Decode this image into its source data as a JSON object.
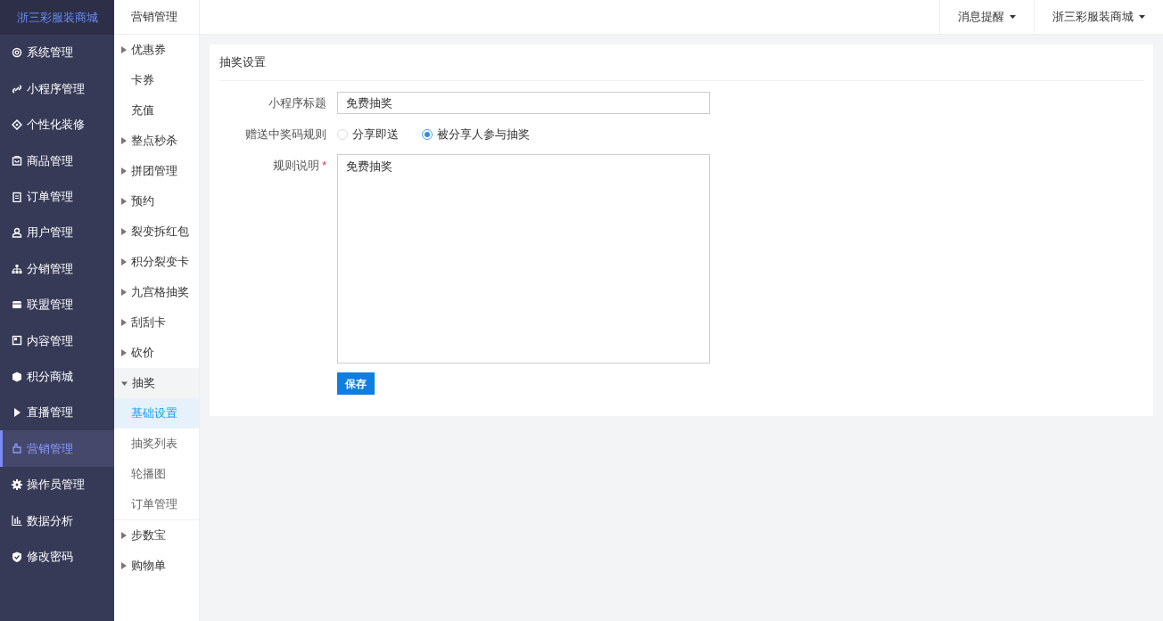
{
  "brand": "浙三彩服装商城",
  "sidebar": {
    "items": [
      {
        "label": "系统管理",
        "selected": false
      },
      {
        "label": "小程序管理",
        "selected": false
      },
      {
        "label": "个性化装修",
        "selected": false
      },
      {
        "label": "商品管理",
        "selected": false
      },
      {
        "label": "订单管理",
        "selected": false
      },
      {
        "label": "用户管理",
        "selected": false
      },
      {
        "label": "分销管理",
        "selected": false
      },
      {
        "label": "联盟管理",
        "selected": false
      },
      {
        "label": "内容管理",
        "selected": false
      },
      {
        "label": "积分商城",
        "selected": false
      },
      {
        "label": "直播管理",
        "selected": false
      },
      {
        "label": "营销管理",
        "selected": true
      },
      {
        "label": "操作员管理",
        "selected": false
      },
      {
        "label": "数据分析",
        "selected": false
      },
      {
        "label": "修改密码",
        "selected": false
      }
    ]
  },
  "submenu": {
    "title": "营销管理",
    "items": [
      {
        "label": "优惠券",
        "kind": "group",
        "expanded": false
      },
      {
        "label": "卡券",
        "kind": "leaf"
      },
      {
        "label": "充值",
        "kind": "leaf"
      },
      {
        "label": "整点秒杀",
        "kind": "group",
        "expanded": false
      },
      {
        "label": "拼团管理",
        "kind": "group",
        "expanded": false
      },
      {
        "label": "预约",
        "kind": "group",
        "expanded": false
      },
      {
        "label": "裂变拆红包",
        "kind": "group",
        "expanded": false
      },
      {
        "label": "积分裂变卡",
        "kind": "group",
        "expanded": false
      },
      {
        "label": "九宫格抽奖",
        "kind": "group",
        "expanded": false
      },
      {
        "label": "刮刮卡",
        "kind": "group",
        "expanded": false
      },
      {
        "label": "砍价",
        "kind": "group",
        "expanded": false
      },
      {
        "label": "抽奖",
        "kind": "group",
        "expanded": true,
        "children": [
          {
            "label": "基础设置",
            "selected": true
          },
          {
            "label": "抽奖列表",
            "selected": false
          },
          {
            "label": "轮播图",
            "selected": false
          },
          {
            "label": "订单管理",
            "selected": false
          }
        ]
      },
      {
        "label": "步数宝",
        "kind": "group",
        "expanded": false
      },
      {
        "label": "购物单",
        "kind": "group",
        "expanded": false
      }
    ]
  },
  "topbar": {
    "menus": [
      "消息提醒",
      "浙三彩服装商城"
    ]
  },
  "card": {
    "title": "抽奖设置",
    "title_field": {
      "label": "小程序标题",
      "value": "免费抽奖"
    },
    "rule_field": {
      "label": "赠送中奖码规则",
      "options": [
        {
          "label": "分享即送",
          "selected": false
        },
        {
          "label": "被分享人参与抽奖",
          "selected": true
        }
      ]
    },
    "desc_field": {
      "label": "规则说明",
      "required_mark": "*",
      "value": "免费抽奖"
    },
    "save_button": "保存"
  }
}
